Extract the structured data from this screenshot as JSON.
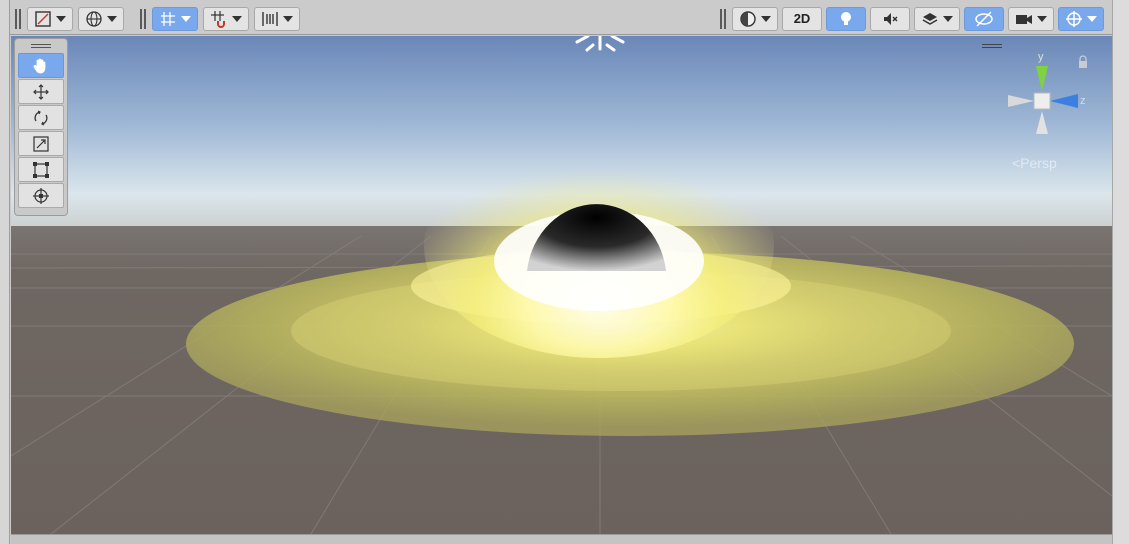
{
  "toolbar": {
    "left_tools": [
      {
        "name": "draw-mode-dropdown",
        "icon": "shading-mode-icon"
      },
      {
        "name": "global-toggle",
        "icon": "globe-icon"
      },
      {
        "name": "grid-snap-toggle",
        "icon": "grid-snap-icon"
      },
      {
        "name": "increment-snap-toggle",
        "icon": "magnet-snap-icon"
      },
      {
        "name": "align-tools",
        "icon": "align-icon"
      }
    ],
    "two_d_label": "2D",
    "right_tools": [
      {
        "name": "render-mode-dropdown",
        "icon": "sphere-icon"
      },
      {
        "name": "lighting-toggle",
        "icon": "lightbulb-icon",
        "active": true
      },
      {
        "name": "audio-toggle",
        "icon": "mute-icon"
      },
      {
        "name": "effects-dropdown",
        "icon": "layers-icon"
      },
      {
        "name": "hidden-objects-toggle",
        "icon": "eye-slash-icon",
        "active": true
      },
      {
        "name": "camera-dropdown",
        "icon": "camera-icon"
      },
      {
        "name": "gizmos-dropdown",
        "icon": "gizmo-icon",
        "active": true
      }
    ]
  },
  "tools": [
    {
      "name": "hand-tool",
      "icon": "hand-icon",
      "active": true
    },
    {
      "name": "move-tool",
      "icon": "move-arrows-icon"
    },
    {
      "name": "rotate-tool",
      "icon": "rotate-icon"
    },
    {
      "name": "scale-tool",
      "icon": "scale-icon"
    },
    {
      "name": "rect-tool",
      "icon": "rect-transform-icon"
    },
    {
      "name": "transform-tool",
      "icon": "transform-icon"
    }
  ],
  "gizmo": {
    "y_label": "y",
    "z_label": "z",
    "projection_label": "<Persp"
  },
  "colors": {
    "active": "#79a9ec",
    "sky_top": "#6f8fbf",
    "horizon": "#dfe8ee",
    "ground": "#6c645f",
    "accretion": "#e9e67a"
  }
}
